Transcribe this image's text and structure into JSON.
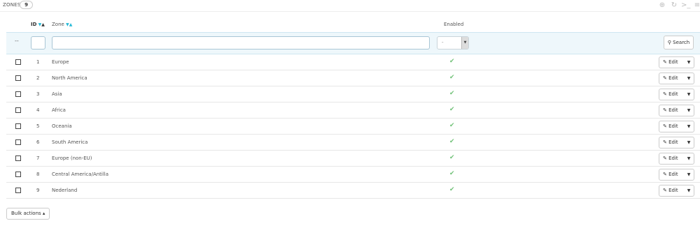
{
  "header": {
    "title": "ZONES",
    "count": "9",
    "tools": [
      "add-icon",
      "refresh-icon",
      "sql-icon",
      "database-icon"
    ]
  },
  "columns": {
    "id": "ID",
    "zone": "Zone",
    "enabled": "Enabled",
    "sort_down": "▼",
    "sort_up": "▲"
  },
  "filters": {
    "dash": "--",
    "enabled_value": "-",
    "search_label": "Search"
  },
  "rows": [
    {
      "id": "1",
      "zone": "Europe",
      "enabled": true
    },
    {
      "id": "2",
      "zone": "North America",
      "enabled": true
    },
    {
      "id": "3",
      "zone": "Asia",
      "enabled": true
    },
    {
      "id": "4",
      "zone": "Africa",
      "enabled": true
    },
    {
      "id": "5",
      "zone": "Oceania",
      "enabled": true
    },
    {
      "id": "6",
      "zone": "South America",
      "enabled": true
    },
    {
      "id": "7",
      "zone": "Europe (non-EU)",
      "enabled": true
    },
    {
      "id": "8",
      "zone": "Central America/Antilla",
      "enabled": true
    },
    {
      "id": "9",
      "zone": "Nederland",
      "enabled": true
    }
  ],
  "row_actions": {
    "edit_label": "Edit"
  },
  "footer": {
    "bulk_actions_label": "Bulk actions ▴"
  },
  "colors": {
    "accent": "#25b9d7",
    "success": "#72c279",
    "filter_bg": "#eef7fb"
  }
}
